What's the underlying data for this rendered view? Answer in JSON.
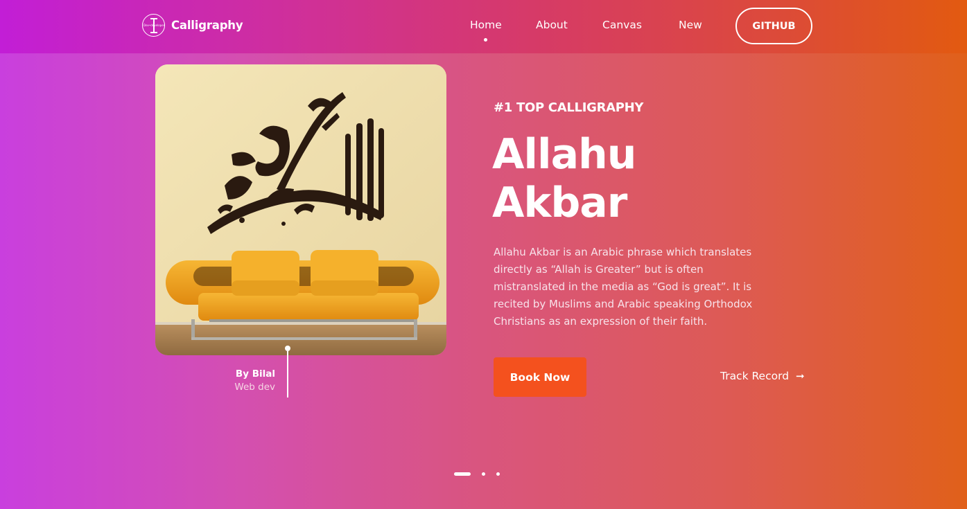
{
  "brand": {
    "name": "Calligraphy",
    "logo_small_text": "Dev•developer"
  },
  "nav": {
    "items": [
      {
        "label": "Home",
        "active": true
      },
      {
        "label": "About",
        "active": false
      },
      {
        "label": "Canvas",
        "active": false
      },
      {
        "label": "New",
        "active": false
      }
    ],
    "github_label": "GITHUB"
  },
  "hero": {
    "image_alt": "Allahu Akbar calligraphy wall art above orange sofa",
    "author_name": "By Bilal",
    "author_role": "Web dev",
    "kicker": "#1 TOP CALLIGRAPHY",
    "title_line1": "Allahu",
    "title_line2": "Akbar",
    "description": "Allahu Akbar is an Arabic phrase which translates directly as “Allah is Greater” but is often mistranslated in the media as “God is great”. It is recited by Muslims and Arabic speaking Orthodox Christians as an expression of their faith.",
    "book_button": "Book Now",
    "track_link": "Track Record",
    "track_icon": "arrow-right-icon"
  },
  "pager": {
    "count": 3,
    "active_index": 0
  },
  "colors": {
    "accent_button": "#f4511e",
    "header_start": "#c21ed6",
    "header_end": "#e25a10"
  }
}
